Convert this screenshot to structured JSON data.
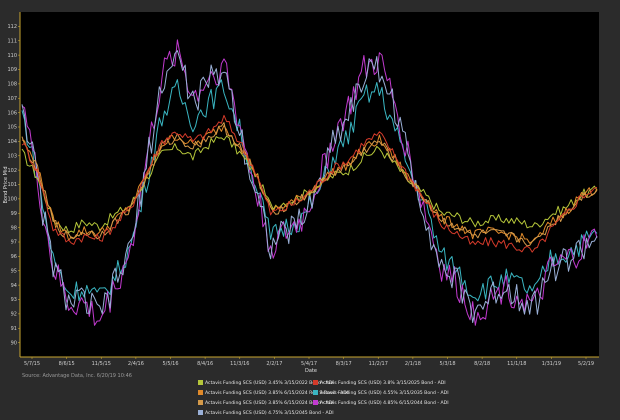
{
  "chart_data": {
    "type": "line",
    "title": "",
    "xlabel": "Date",
    "ylabel": "Bond Price Mid",
    "ylim": [
      89,
      113
    ],
    "y_ticks": [
      90,
      91,
      92,
      93,
      94,
      95,
      96,
      97,
      98,
      99,
      100,
      101,
      102,
      103,
      104,
      105,
      106,
      107,
      108,
      109,
      110,
      111,
      112
    ],
    "x_ticks": [
      "5/7/15",
      "8/6/15",
      "11/5/15",
      "2/4/16",
      "5/5/16",
      "8/4/16",
      "11/3/16",
      "2/2/17",
      "5/4/17",
      "8/3/17",
      "11/2/17",
      "2/1/18",
      "5/3/18",
      "8/2/18",
      "11/1/18",
      "1/31/19",
      "5/2/19"
    ],
    "grid": false,
    "legend_position": "bottom",
    "source_note": "Source: Advantage Data, Inc. 6/20/19 10:46",
    "series": [
      {
        "name": "Actavis Funding SCS (USD) 3.45% 3/15/2022 Bond - ADI",
        "color": "#b5c63a",
        "values": [
          103.2,
          101.5,
          98.6,
          97.8,
          98.4,
          98.1,
          98.9,
          99.6,
          101.4,
          103.1,
          103.6,
          102.9,
          103.8,
          104.4,
          103.2,
          101.8,
          99.5,
          99.8,
          100.2,
          100.9,
          101.6,
          102.0,
          102.9,
          103.5,
          102.4,
          101.1,
          100.2,
          99.0,
          98.8,
          98.3,
          98.5,
          98.6,
          98.4,
          98.1,
          98.9,
          99.4,
          100.3,
          100.6
        ]
      },
      {
        "name": "Actavis Funding SCS (USD) 3.8% 3/15/2025 Bond - ADI",
        "color": "#d43a2a",
        "values": [
          104.0,
          101.9,
          98.0,
          97.0,
          97.4,
          97.2,
          98.2,
          99.4,
          101.8,
          104.0,
          104.7,
          104.0,
          104.6,
          105.6,
          104.0,
          102.0,
          99.0,
          99.4,
          100.0,
          101.0,
          102.1,
          102.7,
          103.9,
          104.5,
          103.0,
          101.4,
          99.8,
          98.2,
          97.6,
          96.8,
          97.0,
          96.9,
          96.6,
          96.3,
          97.8,
          98.9,
          100.2,
          100.8
        ]
      },
      {
        "name": "Actavis Funding SCS (USD) 3.85% 6/15/2024 Reg S Bond - ADI",
        "color": "#e08a2a",
        "values": [
          104.2,
          102.1,
          98.5,
          97.4,
          97.8,
          97.6,
          98.5,
          99.5,
          101.6,
          103.8,
          104.4,
          103.7,
          104.4,
          105.1,
          103.8,
          101.9,
          99.2,
          99.6,
          100.1,
          101.0,
          101.9,
          102.4,
          103.5,
          104.1,
          102.8,
          101.3,
          100.0,
          98.6,
          98.2,
          97.5,
          97.7,
          97.6,
          97.3,
          97.0,
          98.3,
          99.1,
          100.3,
          100.7
        ]
      },
      {
        "name": "Actavis Funding SCS (USD) 4.55% 3/15/2035 Bond - ADI",
        "color": "#3ab6c2",
        "values": [
          106.0,
          101.5,
          95.8,
          93.5,
          93.8,
          93.1,
          94.6,
          96.7,
          101.2,
          105.8,
          107.6,
          105.4,
          106.7,
          107.8,
          104.8,
          101.3,
          97.3,
          98.1,
          98.6,
          100.3,
          102.8,
          104.4,
          107.1,
          107.6,
          104.8,
          101.8,
          99.4,
          96.0,
          95.2,
          93.4,
          93.9,
          94.4,
          94.1,
          93.4,
          95.8,
          96.2,
          96.9,
          97.6
        ]
      },
      {
        "name": "Actavis Funding SCS (USD) 3.85% 6/15/2024 Bond - ADI",
        "color": "#d49a4a",
        "values": [
          104.1,
          102.0,
          98.4,
          97.3,
          97.7,
          97.5,
          98.4,
          99.4,
          101.5,
          103.7,
          104.3,
          103.6,
          104.3,
          105.0,
          103.7,
          101.8,
          99.1,
          99.5,
          100.0,
          100.9,
          101.8,
          102.3,
          103.4,
          104.0,
          102.7,
          101.2,
          99.9,
          98.5,
          98.1,
          97.4,
          97.6,
          97.5,
          97.2,
          96.9,
          98.2,
          99.0,
          100.2,
          100.6
        ]
      },
      {
        "name": "Actavis Funding SCS (USD) 4.85% 6/15/2044 Bond - ADI",
        "color": "#c23ad0",
        "values": [
          107.4,
          101.2,
          95.2,
          92.7,
          92.6,
          91.5,
          93.9,
          96.5,
          102.6,
          108.4,
          110.6,
          107.0,
          108.4,
          109.4,
          105.1,
          100.8,
          96.7,
          97.6,
          98.5,
          100.9,
          104.2,
          106.3,
          108.9,
          109.6,
          106.6,
          102.5,
          98.8,
          95.2,
          94.0,
          92.1,
          92.8,
          93.9,
          93.2,
          92.4,
          95.0,
          95.6,
          96.4,
          97.3
        ]
      },
      {
        "name": "Actavis Funding SCS (USD) 4.75% 3/15/2045 Bond - ADI",
        "color": "#9ab0d8",
        "values": [
          107.0,
          101.1,
          95.4,
          92.9,
          92.9,
          91.9,
          94.1,
          96.6,
          102.4,
          108.0,
          110.1,
          106.7,
          108.1,
          109.1,
          104.9,
          100.7,
          96.8,
          97.7,
          98.5,
          100.8,
          104.0,
          106.0,
          108.6,
          109.2,
          106.3,
          102.3,
          98.7,
          95.2,
          94.1,
          92.3,
          92.9,
          94.0,
          93.3,
          92.6,
          95.1,
          95.7,
          96.5,
          97.4
        ]
      }
    ]
  }
}
